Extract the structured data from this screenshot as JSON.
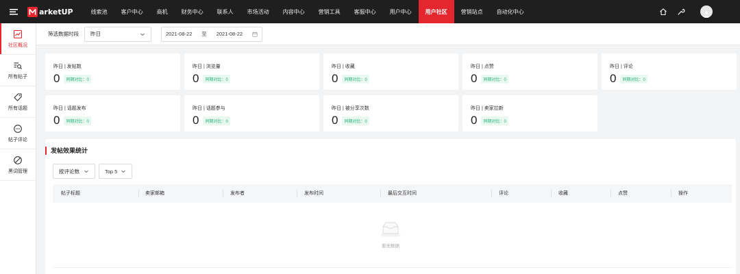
{
  "header": {
    "logo_text": "arketUP",
    "logo_letter": "M",
    "nav": [
      "线索池",
      "客户中心",
      "商机",
      "财务中心",
      "联系人",
      "市场活动",
      "内容中心",
      "营销工具",
      "客服中心",
      "用户中心",
      "用户社区",
      "营销站点",
      "自动化中心"
    ],
    "active_nav": "用户社区"
  },
  "sidebar": {
    "items": [
      {
        "label": "社区概况",
        "icon": "chart-line-icon",
        "active": true
      },
      {
        "label": "所有帖子",
        "icon": "list-search-icon",
        "active": false
      },
      {
        "label": "所有话题",
        "icon": "tag-icon",
        "active": false
      },
      {
        "label": "帖子评论",
        "icon": "comment-icon",
        "active": false
      },
      {
        "label": "黑词管理",
        "icon": "ban-icon",
        "active": false
      }
    ]
  },
  "filter": {
    "label": "筛选数据时段",
    "period": "昨日",
    "date_start": "2021-08-22",
    "date_sep": "至",
    "date_end": "2021-08-22"
  },
  "cards": [
    {
      "title": "昨日 | 发帖数",
      "value": "0",
      "compare": "同期对比：0"
    },
    {
      "title": "昨日 | 浏览量",
      "value": "0",
      "compare": "同期对比：0"
    },
    {
      "title": "昨日 | 收藏",
      "value": "0",
      "compare": "同期对比：0"
    },
    {
      "title": "昨日 | 点赞",
      "value": "0",
      "compare": "同期对比：0"
    },
    {
      "title": "昨日 | 评论",
      "value": "0",
      "compare": "同期对比：0"
    },
    {
      "title": "昨日 | 话题发布",
      "value": "0",
      "compare": "同期对比：0"
    },
    {
      "title": "昨日 | 话题参与",
      "value": "0",
      "compare": "同期对比：0"
    },
    {
      "title": "昨日 | 被分享次数",
      "value": "0",
      "compare": "同期对比：0"
    },
    {
      "title": "昨日 | 卖家拉新",
      "value": "0",
      "compare": "同期对比：0"
    }
  ],
  "panel": {
    "title": "发帖效果统计",
    "sort_select": "按评论数",
    "top_select": "Top 5",
    "columns": [
      "帖子标题",
      "卖家邮箱",
      "发布者",
      "发布时间",
      "最后交互时间",
      "评论",
      "收藏",
      "点赞",
      "操作"
    ],
    "empty_text": "暂无数据"
  },
  "colors": {
    "accent": "#e4262f",
    "topbar": "#1f1f1f",
    "compare_text": "#28b27a",
    "compare_bg": "#e9f8f1"
  }
}
